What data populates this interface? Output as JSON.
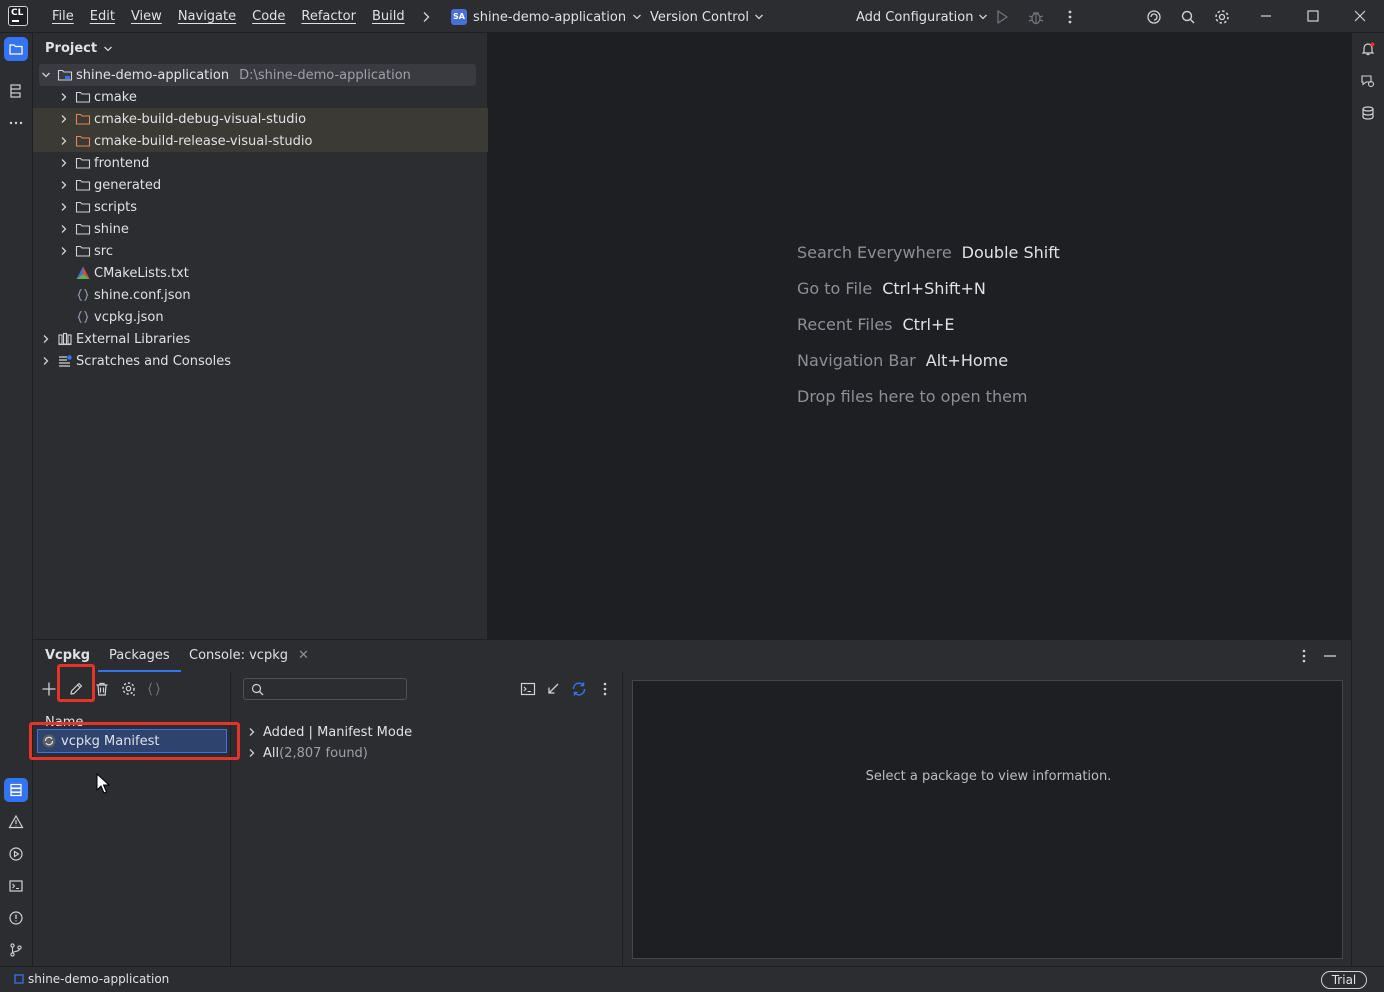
{
  "app": {
    "logo_text_top": "CL",
    "logo_text_bottom": ""
  },
  "menu": [
    "File",
    "Edit",
    "View",
    "Navigate",
    "Code",
    "Refactor",
    "Build"
  ],
  "toolbar": {
    "project_badge": "SA",
    "project_name": "shine-demo-application",
    "vcs_label": "Version Control",
    "run_config_label": "Add Configuration"
  },
  "project_panel": {
    "title": "Project",
    "root": {
      "name": "shine-demo-application",
      "path": "D:\\shine-demo-application"
    },
    "items": [
      {
        "name": "cmake",
        "kind": "folder",
        "level": 1,
        "expandable": true,
        "excluded": false
      },
      {
        "name": "cmake-build-debug-visual-studio",
        "kind": "folder-excluded",
        "level": 1,
        "expandable": true,
        "excluded": true
      },
      {
        "name": "cmake-build-release-visual-studio",
        "kind": "folder-excluded",
        "level": 1,
        "expandable": true,
        "excluded": true
      },
      {
        "name": "frontend",
        "kind": "folder",
        "level": 1,
        "expandable": true,
        "excluded": false
      },
      {
        "name": "generated",
        "kind": "folder",
        "level": 1,
        "expandable": true,
        "excluded": false
      },
      {
        "name": "scripts",
        "kind": "folder",
        "level": 1,
        "expandable": true,
        "excluded": false
      },
      {
        "name": "shine",
        "kind": "folder",
        "level": 1,
        "expandable": true,
        "excluded": false
      },
      {
        "name": "src",
        "kind": "folder",
        "level": 1,
        "expandable": true,
        "excluded": false
      },
      {
        "name": "CMakeLists.txt",
        "kind": "cmake-file",
        "level": 1,
        "expandable": false,
        "excluded": false
      },
      {
        "name": "shine.conf.json",
        "kind": "json-file",
        "level": 1,
        "expandable": false,
        "excluded": false
      },
      {
        "name": "vcpkg.json",
        "kind": "json-file",
        "level": 1,
        "expandable": false,
        "excluded": false
      },
      {
        "name": "External Libraries",
        "kind": "libraries",
        "level": 0,
        "expandable": true,
        "excluded": false
      },
      {
        "name": "Scratches and Consoles",
        "kind": "scratches",
        "level": 0,
        "expandable": true,
        "excluded": false
      }
    ]
  },
  "editor_hints": [
    {
      "action": "Search Everywhere",
      "shortcut": "Double Shift"
    },
    {
      "action": "Go to File",
      "shortcut": "Ctrl+Shift+N"
    },
    {
      "action": "Recent Files",
      "shortcut": "Ctrl+E"
    },
    {
      "action": "Navigation Bar",
      "shortcut": "Alt+Home"
    },
    {
      "action": "Drop files here to open them",
      "shortcut": ""
    }
  ],
  "bottom_panel": {
    "tabs": {
      "vcpkg": "Vcpkg",
      "packages": "Packages",
      "console": "Console: vcpkg"
    },
    "list_header": "Name",
    "selected_item": "vcpkg Manifest",
    "search_placeholder": "",
    "groups": [
      {
        "label": "Added | Manifest Mode",
        "count": ""
      },
      {
        "label": "All",
        "count": "(2,807 found)"
      }
    ],
    "info_message": "Select a package to view information."
  },
  "statusbar": {
    "project": "shine-demo-application",
    "trial": "Trial"
  },
  "colors": {
    "accent": "#3574f0",
    "highlight": "#e5332a",
    "excluded_folder": "#e08855"
  }
}
